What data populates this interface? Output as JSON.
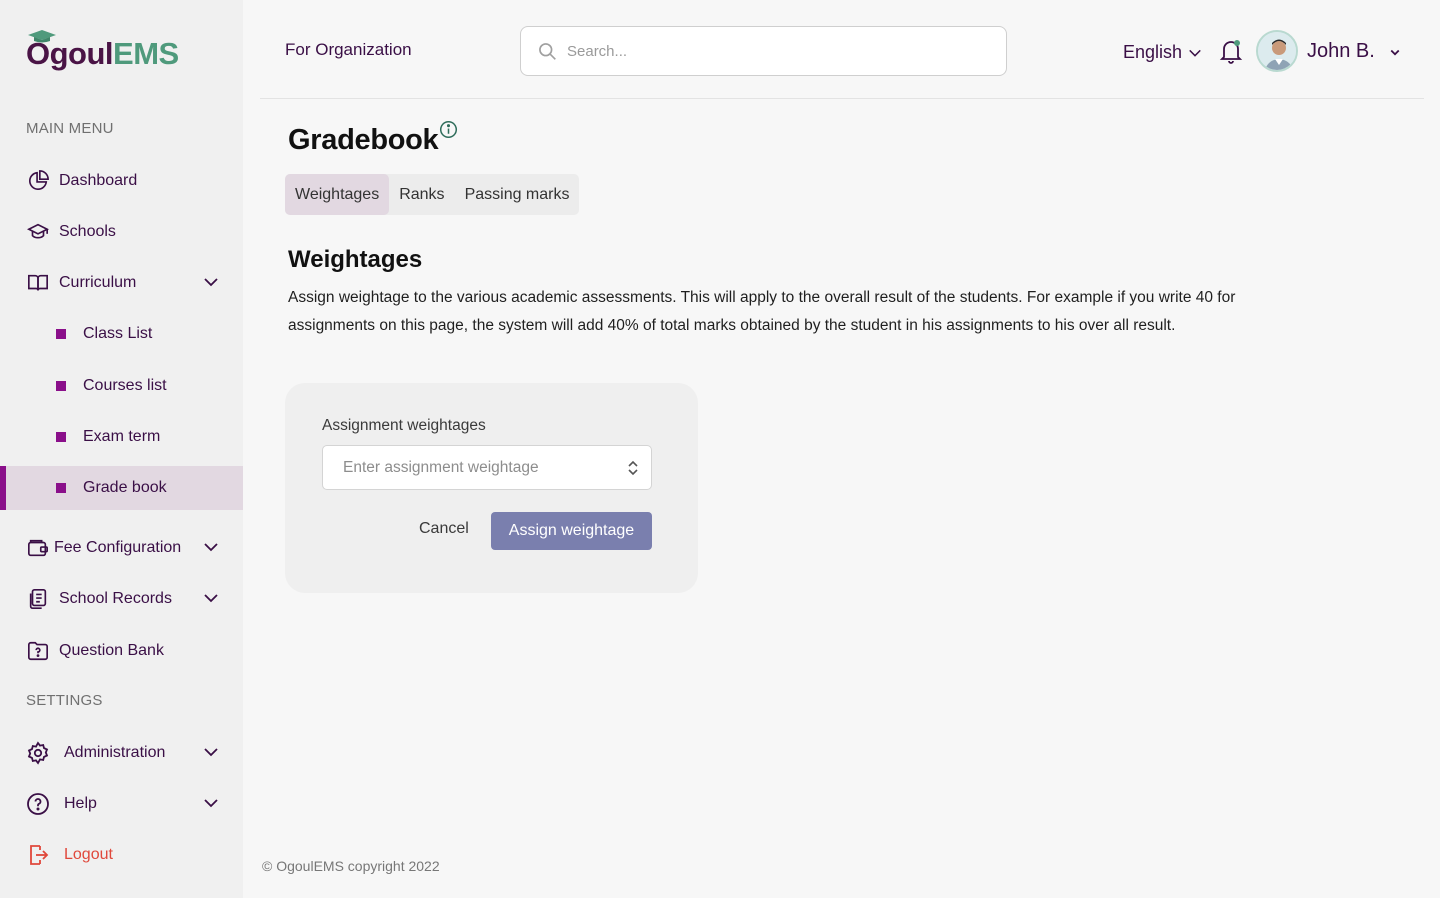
{
  "brand": {
    "part1": "Ogoul",
    "part2": "EMS"
  },
  "sidebar": {
    "main_menu_label": "MAIN MENU",
    "settings_label": "SETTINGS",
    "items": {
      "dashboard": "Dashboard",
      "schools": "Schools",
      "curriculum": "Curriculum",
      "class_list": "Class List",
      "courses_list": "Courses list",
      "exam_term": "Exam term",
      "grade_book": "Grade book",
      "fee_configuration": "Fee Configuration",
      "school_records": "School Records",
      "question_bank": "Question Bank",
      "administration": "Administration",
      "help": "Help",
      "logout": "Logout"
    }
  },
  "header": {
    "org_label": "For Organization",
    "search_placeholder": "Search...",
    "language": "English",
    "user_name": "John B."
  },
  "main": {
    "title": "Gradebook",
    "tabs": [
      "Weightages",
      "Ranks",
      "Passing marks"
    ],
    "section_title": "Weightages",
    "description": "Assign weightage to the various academic assessments. This will apply to the overall result of the students. For example if you write 40 for assignments on this page, the system will add 40% of total marks obtained by the student in his assignments to his over all result.",
    "form": {
      "label": "Assignment weightages",
      "placeholder": "Enter assignment weightage",
      "cancel": "Cancel",
      "submit": "Assign weightage"
    }
  },
  "footer": {
    "copyright": "© OgoulEMS copyright 2022"
  },
  "colors": {
    "accent": "#8a0f8a",
    "nav_text": "#3a0f46",
    "brand_green": "#4f9a7c",
    "button": "#7a7fae",
    "logout": "#e0483b"
  }
}
